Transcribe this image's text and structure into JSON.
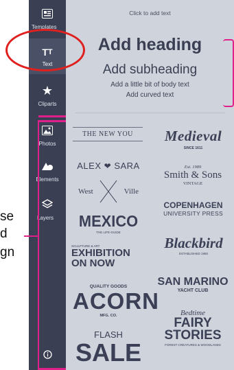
{
  "sidebar": {
    "items": [
      {
        "key": "templates",
        "label": "Templates",
        "icon": "templates-icon"
      },
      {
        "key": "text",
        "label": "Text",
        "icon": "text-icon"
      },
      {
        "key": "cliparts",
        "label": "Cliparts",
        "icon": "star-icon"
      },
      {
        "key": "photos",
        "label": "Photos",
        "icon": "photo-icon"
      },
      {
        "key": "elements",
        "label": "Elements",
        "icon": "shapes-icon"
      },
      {
        "key": "layers",
        "label": "Layers",
        "icon": "layers-icon"
      },
      {
        "key": "info",
        "label": "",
        "icon": "info-icon"
      }
    ]
  },
  "panel": {
    "hint": "Click to add text",
    "heading": "Add heading",
    "subheading": "Add subheading",
    "body": "Add a little bit of body text",
    "curved": "Add curved text"
  },
  "font_combos": [
    {
      "line1": "THE NEW YOU"
    },
    {
      "line1": "Medieval",
      "line2": "SINCE 1611"
    },
    {
      "line1": "ALEX",
      "sym": "❤",
      "line2": "SARA"
    },
    {
      "line1": "Est. 1989",
      "line2": "Smith & Sons",
      "line3": "VINTAGE"
    },
    {
      "line1": "West",
      "line2": "Ville"
    },
    {
      "line1": "COPENHAGEN",
      "line2": "UNIVERSITY PRESS"
    },
    {
      "line1": "MEXICO",
      "line2": "THE LIFE-GUIDE"
    },
    {
      "line1": "Blackbird",
      "line2": "ESTABLISHED 1950"
    },
    {
      "line1": "SCULPTURE & ART",
      "line2": "EXHIBITION",
      "line3": "ON NOW"
    },
    {
      "line1": "SAN MARINO",
      "line2": "YACHT CLUB"
    },
    {
      "line1": "QUALITY GOODS",
      "line2": "ACORN",
      "line3": "MFG. CO."
    },
    {
      "line1": "Bedtime",
      "line2": "FAIRY",
      "line3": "STORIES",
      "line4": "FOREST CREATURES & WOODLANDS"
    },
    {
      "line1": "FLASH",
      "line2": "SALE"
    }
  ],
  "side_caption": [
    "se",
    "d",
    "gn"
  ],
  "colors": {
    "sidebar": "#3a3f53",
    "panel": "#cfd3db",
    "accent": "#e0208a",
    "circle": "#e0201e"
  }
}
